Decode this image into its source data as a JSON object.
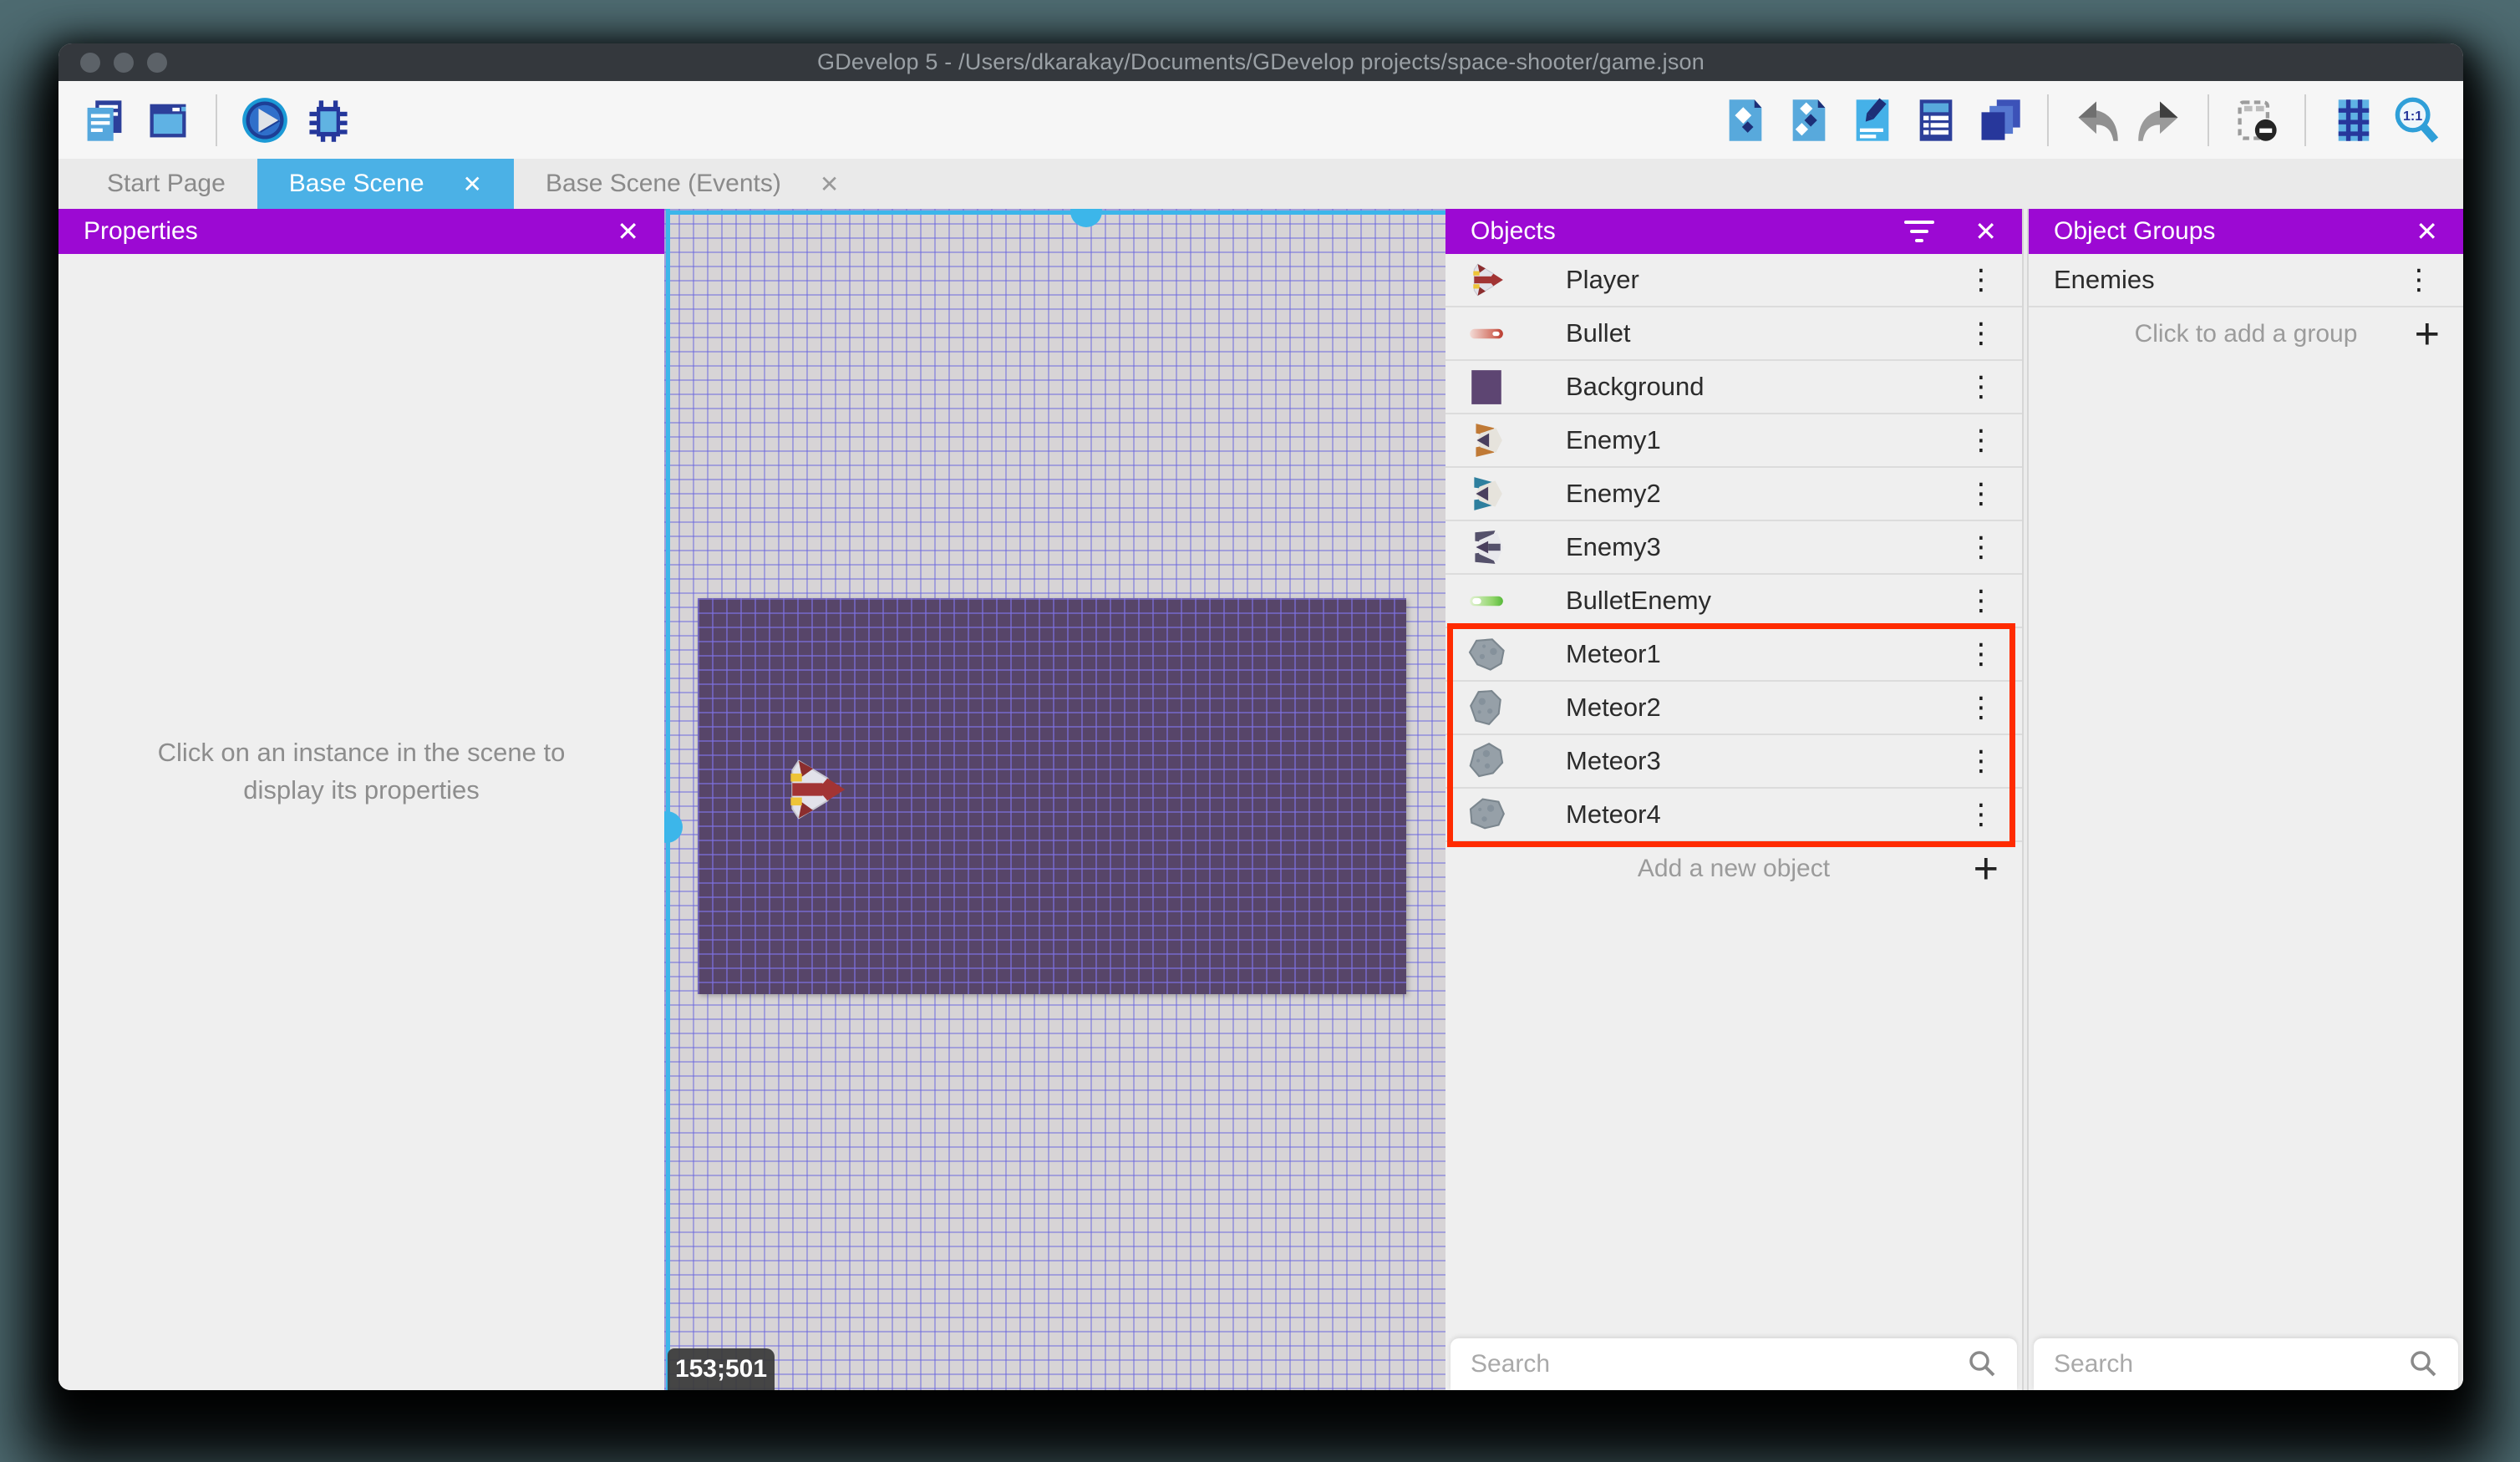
{
  "window": {
    "title": "GDevelop 5 - /Users/dkarakay/Documents/GDevelop projects/space-shooter/game.json"
  },
  "toolbar": {
    "left": [
      "project-manager-icon",
      "scene-window-icon",
      "separator",
      "play-icon",
      "debug-icon"
    ],
    "right": [
      "objects-editor-icon",
      "object-groups-editor-icon",
      "properties-editor-icon",
      "instances-list-icon",
      "layers-editor-icon",
      "separator",
      "undo-icon",
      "redo-icon",
      "separator",
      "mask-icon",
      "separator",
      "grid-icon",
      "zoom-ratio-icon"
    ]
  },
  "tabs": [
    {
      "label": "Start Page",
      "active": false,
      "closable": false
    },
    {
      "label": "Base Scene",
      "active": true,
      "closable": true
    },
    {
      "label": "Base Scene (Events)",
      "active": false,
      "closable": true
    }
  ],
  "properties_panel": {
    "title": "Properties",
    "close_icon": "close-icon",
    "empty_message": "Click on an instance in the scene to display its properties"
  },
  "scene": {
    "cursor_coordinates": "153;501",
    "selection_handles": [
      "top-center-handle",
      "left-middle-handle"
    ]
  },
  "objects_panel": {
    "title": "Objects",
    "header_icons": [
      "filter-icon",
      "close-icon"
    ],
    "items": [
      {
        "name": "Player",
        "icon": "player"
      },
      {
        "name": "Bullet",
        "icon": "bullet"
      },
      {
        "name": "Background",
        "icon": "background"
      },
      {
        "name": "Enemy1",
        "icon": "enemy1"
      },
      {
        "name": "Enemy2",
        "icon": "enemy2"
      },
      {
        "name": "Enemy3",
        "icon": "enemy3"
      },
      {
        "name": "BulletEnemy",
        "icon": "bullet-enemy"
      },
      {
        "name": "Meteor1",
        "icon": "meteor"
      },
      {
        "name": "Meteor2",
        "icon": "meteor"
      },
      {
        "name": "Meteor3",
        "icon": "meteor"
      },
      {
        "name": "Meteor4",
        "icon": "meteor"
      }
    ],
    "highlighted_items": [
      "Meteor1",
      "Meteor2",
      "Meteor3",
      "Meteor4"
    ],
    "add_button_label": "Add a new object",
    "search_placeholder": "Search"
  },
  "groups_panel": {
    "title": "Object Groups",
    "header_icons": [
      "close-icon"
    ],
    "groups": [
      {
        "name": "Enemies"
      }
    ],
    "add_button_label": "Click to add a group",
    "search_placeholder": "Search"
  },
  "colors": {
    "accent_purple": "#9c09d3",
    "active_tab_blue": "#4bb1e6",
    "selection_cyan": "#3cb6ea",
    "highlight_red": "#ff2b00",
    "titlebar_gray": "#34383d",
    "background_object_purple": "#574569"
  }
}
